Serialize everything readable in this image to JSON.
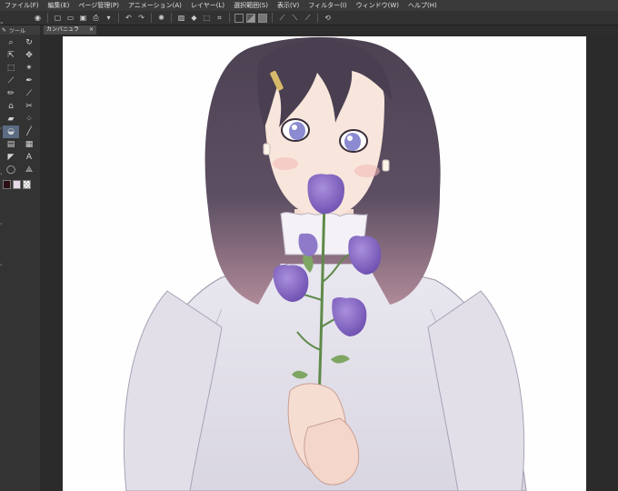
{
  "menu": [
    "ファイル(F)",
    "編集(E)",
    "ページ管理(P)",
    "アニメーション(A)",
    "レイヤー(L)",
    "選択範囲(S)",
    "表示(V)",
    "フィルター(I)",
    "ウィンドウ(W)",
    "ヘルプ(H)"
  ],
  "tool_panel": {
    "title": "ツール"
  },
  "canvas_tab": {
    "label": "カンバニュラ",
    "close": "×"
  },
  "colors": {
    "main": "#2a0f14",
    "sub": "#e9d9e6",
    "accent": "#5a6b82"
  }
}
